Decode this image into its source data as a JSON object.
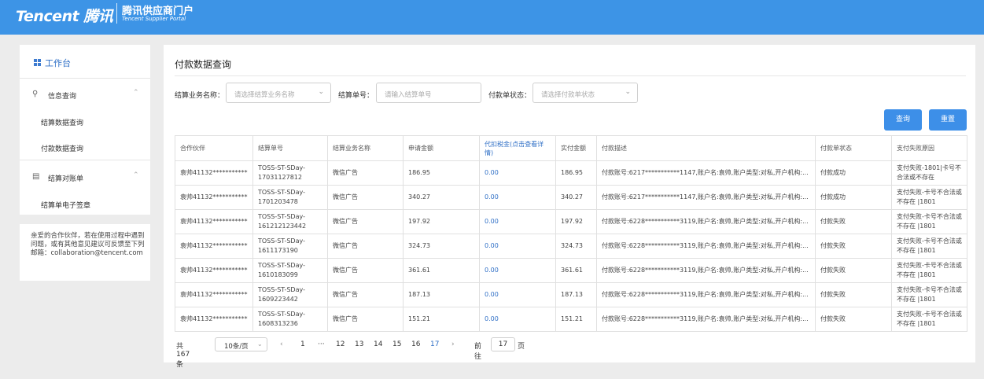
{
  "header": {
    "logo": "Tencent 腾讯",
    "portal_title": "腾讯供应商门户",
    "portal_subtitle": "Tencent Supplier Portal"
  },
  "sidebar": {
    "workbench": "工作台",
    "groups": [
      {
        "label": "信息查询",
        "icon": "search-icon",
        "items": [
          "结算数据查询",
          "付款数据查询"
        ]
      },
      {
        "label": "结算对账单",
        "icon": "document-icon",
        "items": [
          "结算单电子签章"
        ]
      }
    ],
    "note": "亲爱的合作伙伴，若在使用过程中遇到问题，或有其他意见建议可反馈至下列邮箱：collaboration@tencent.com"
  },
  "main": {
    "title": "付款数据查询",
    "filters": {
      "business_label": "结算业务名称：",
      "business_placeholder": "请选择结算业务名称",
      "number_label": "结算单号：",
      "number_placeholder": "请输入结算单号",
      "status_label": "付款单状态：",
      "status_placeholder": "请选择付款单状态"
    },
    "buttons": {
      "query": "查询",
      "reset": "重置"
    },
    "table": {
      "headers": [
        "合作伙伴",
        "结算单号",
        "结算业务名称",
        "申请金额",
        "代扣税金(点击查看详情)",
        "实付金额",
        "付款描述",
        "付款单状态",
        "支付失败原因"
      ],
      "rows": [
        {
          "partner": "袁帅41132***********",
          "order": "TOSS-ST-SDay-17031127812",
          "business": "微信广告",
          "apply": "186.95",
          "tax": "0.00",
          "paid": "186.95",
          "desc": "付款账号:6217***********1147,账户名:袁帅,账户类型:对私,开户机构:...",
          "status": "付款成功",
          "reason": "支付失败-1801|卡号不合法或不存在"
        },
        {
          "partner": "袁帅41132***********",
          "order": "TOSS-ST-SDay-1701203478",
          "business": "微信广告",
          "apply": "340.27",
          "tax": "0.00",
          "paid": "340.27",
          "desc": "付款账号:6217***********1147,账户名:袁帅,账户类型:对私,开户机构:...",
          "status": "付款成功",
          "reason": "支付失败-卡号不合法或不存在 |1801"
        },
        {
          "partner": "袁帅41132***********",
          "order": "TOSS-ST-SDay-161212123442",
          "business": "微信广告",
          "apply": "197.92",
          "tax": "0.00",
          "paid": "197.92",
          "desc": "付款账号:6228***********3119,账户名:袁帅,账户类型:对私,开户机构:...",
          "status": "付款失败",
          "reason": "支付失败-卡号不合法或不存在 |1801"
        },
        {
          "partner": "袁帅41132***********",
          "order": "TOSS-ST-SDay-1611173190",
          "business": "微信广告",
          "apply": "324.73",
          "tax": "0.00",
          "paid": "324.73",
          "desc": "付款账号:6228***********3119,账户名:袁帅,账户类型:对私,开户机构:...",
          "status": "付款失败",
          "reason": "支付失败-卡号不合法或不存在 |1801"
        },
        {
          "partner": "袁帅41132***********",
          "order": "TOSS-ST-SDay-1610183099",
          "business": "微信广告",
          "apply": "361.61",
          "tax": "0.00",
          "paid": "361.61",
          "desc": "付款账号:6228***********3119,账户名:袁帅,账户类型:对私,开户机构:...",
          "status": "付款失败",
          "reason": "支付失败-卡号不合法或不存在 |1801"
        },
        {
          "partner": "袁帅41132***********",
          "order": "TOSS-ST-SDay-1609223442",
          "business": "微信广告",
          "apply": "187.13",
          "tax": "0.00",
          "paid": "187.13",
          "desc": "付款账号:6228***********3119,账户名:袁帅,账户类型:对私,开户机构:...",
          "status": "付款失败",
          "reason": "支付失败-卡号不合法或不存在 |1801"
        },
        {
          "partner": "袁帅41132***********",
          "order": "TOSS-ST-SDay-1608313236",
          "business": "微信广告",
          "apply": "151.21",
          "tax": "0.00",
          "paid": "151.21",
          "desc": "付款账号:6228***********3119,账户名:袁帅,账户类型:对私,开户机构:...",
          "status": "付款失败",
          "reason": "支付失败-卡号不合法或不存在 |1801"
        }
      ]
    },
    "pagination": {
      "total": "共 167 条",
      "page_size": "10条/页",
      "pages": [
        "1",
        "···",
        "12",
        "13",
        "14",
        "15",
        "16",
        "17"
      ],
      "current": "17",
      "goto_label": "前往",
      "goto_value": "17",
      "goto_suffix": "页"
    }
  },
  "colors": {
    "header": "#3d94e6",
    "accent": "#2f6fc6",
    "button": "#3d8fe8"
  }
}
